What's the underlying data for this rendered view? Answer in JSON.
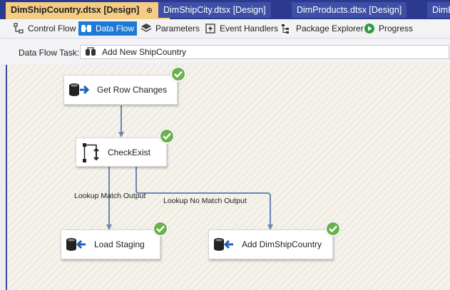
{
  "tabs": [
    {
      "label": "DimShipCountry.dtsx [Design]",
      "active": true,
      "pin": "⊕",
      "close": "×"
    },
    {
      "label": "DimShipCity.dtsx [Design]",
      "active": false
    },
    {
      "label": "DimProducts.dtsx [Design]",
      "active": false
    },
    {
      "label": "DimE",
      "active": false
    }
  ],
  "toolbar": {
    "items": [
      {
        "label": "Control Flow",
        "icon": "control-flow-icon",
        "selected": false
      },
      {
        "label": "Data Flow",
        "icon": "data-flow-icon",
        "selected": true
      },
      {
        "label": "Parameters",
        "icon": "parameters-icon",
        "selected": false
      },
      {
        "label": "Event Handlers",
        "icon": "event-handlers-icon",
        "selected": false
      },
      {
        "label": "Package Explorer",
        "icon": "package-explorer-icon",
        "selected": false
      },
      {
        "label": "Progress",
        "icon": "progress-icon",
        "selected": false
      }
    ]
  },
  "task": {
    "label": "Data Flow Task:",
    "value": "Add New ShipCountry"
  },
  "canvas": {
    "nodes": [
      {
        "label": "Get Row Changes",
        "icon": "source-icon",
        "status": "success"
      },
      {
        "label": "CheckExist",
        "icon": "lookup-icon",
        "status": "success"
      },
      {
        "label": "Load Staging",
        "icon": "destination-icon",
        "status": "success"
      },
      {
        "label": "Add DimShipCountry",
        "icon": "destination-icon",
        "status": "success"
      }
    ],
    "paths": [
      {
        "label": "Lookup Match Output"
      },
      {
        "label": "Lookup No Match Output"
      }
    ]
  },
  "colors": {
    "tabstrip": "#2b3a8f",
    "active_tab": "#f5cc84",
    "selected_button": "#1c7ad6",
    "success": "#6ab04c",
    "connector": "#6b86b0"
  }
}
